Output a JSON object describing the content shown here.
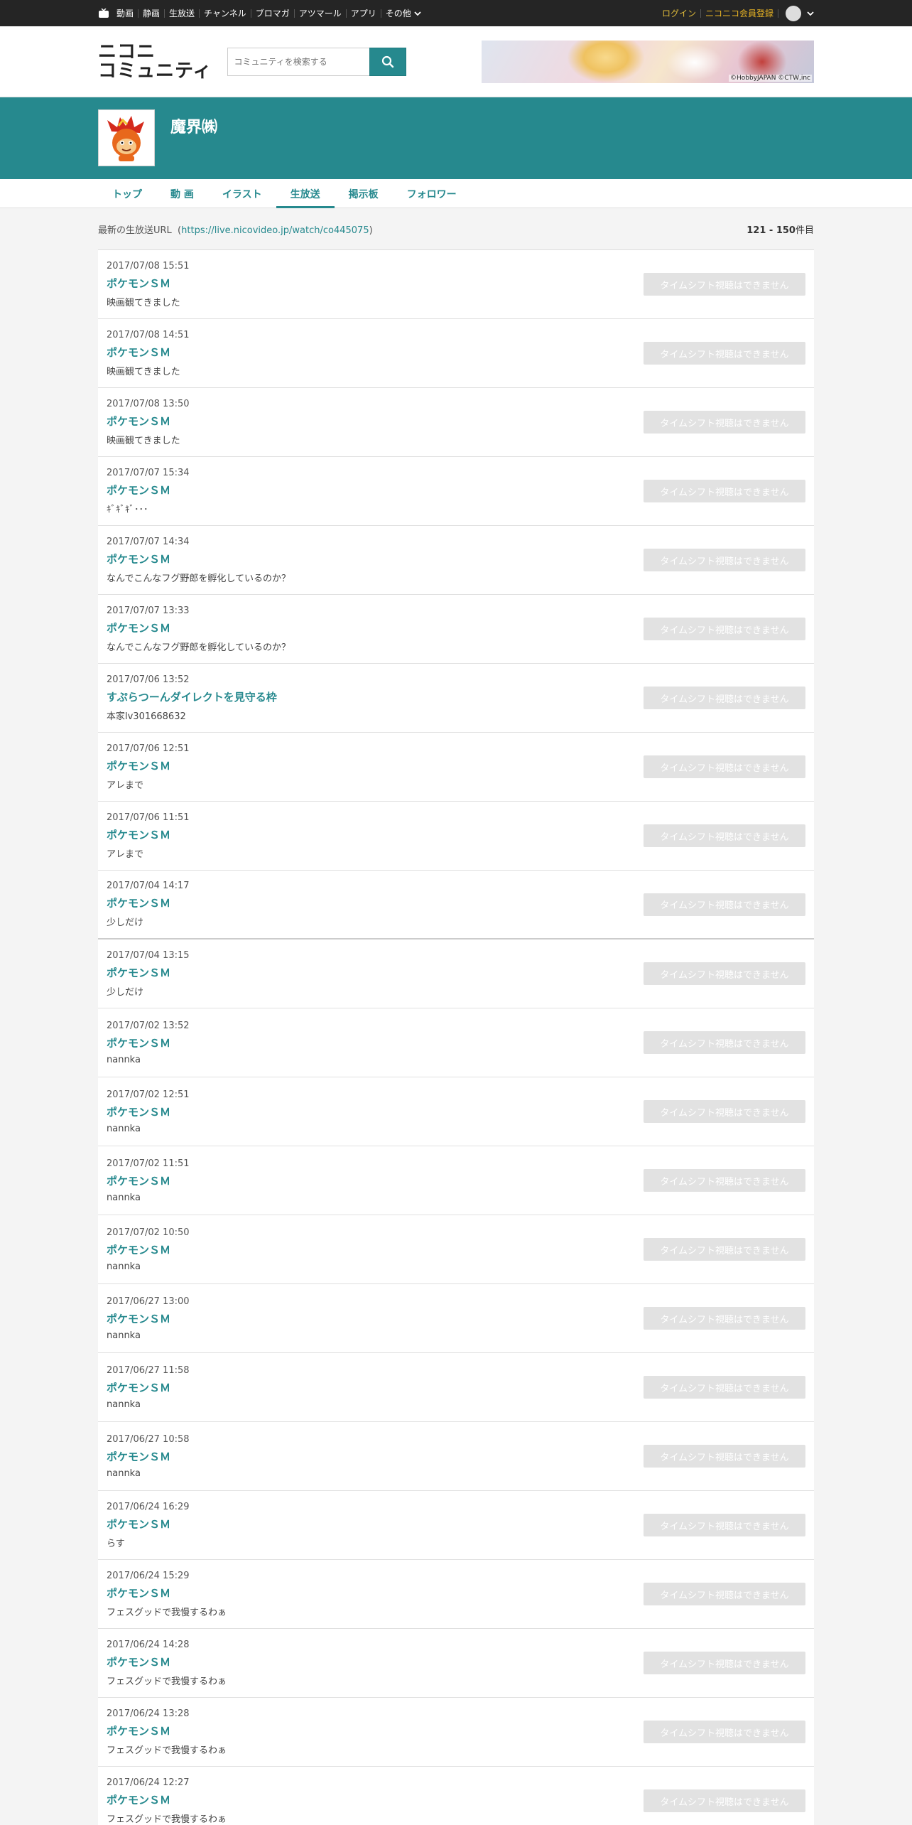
{
  "topbar": {
    "nav": [
      "動画",
      "静画",
      "生放送",
      "チャンネル",
      "ブロマガ",
      "アツマール",
      "アプリ"
    ],
    "more": "その他",
    "login": "ログイン",
    "register": "ニコニコ会員登録"
  },
  "header": {
    "logo_line1": "ニコニ",
    "logo_line2": "コミュニティ",
    "search_placeholder": "コミュニティを検索する",
    "banner_credit": "©HobbyJAPAN ©CTW,inc"
  },
  "community": {
    "name": "魔界㈱"
  },
  "tabs": [
    {
      "label": "トップ"
    },
    {
      "label": "動 画"
    },
    {
      "label": "イラスト"
    },
    {
      "label": "生放送"
    },
    {
      "label": "掲示板"
    },
    {
      "label": "フォロワー"
    }
  ],
  "active_tab": "生放送",
  "latest": {
    "label": "最新の生放送URL",
    "url": "https://live.nicovideo.jp/watch/co445075",
    "range": "121 - 150",
    "range_unit": "件目"
  },
  "timeshift_label": "タイムシフト視聴はできません",
  "broadcasts": [
    {
      "date": "2017/07/08 15:51",
      "title": "ポケモンＳＭ",
      "desc": "映画観てきました"
    },
    {
      "date": "2017/07/08 14:51",
      "title": "ポケモンＳＭ",
      "desc": "映画観てきました"
    },
    {
      "date": "2017/07/08 13:50",
      "title": "ポケモンＳＭ",
      "desc": "映画観てきました"
    },
    {
      "date": "2017/07/07 15:34",
      "title": "ポケモンＳＭ",
      "desc": "ｷﾞｷﾞｷﾞ･･･"
    },
    {
      "date": "2017/07/07 14:34",
      "title": "ポケモンＳＭ",
      "desc": "なんでこんなフグ野郎を孵化しているのか？"
    },
    {
      "date": "2017/07/07 13:33",
      "title": "ポケモンＳＭ",
      "desc": "なんでこんなフグ野郎を孵化しているのか？"
    },
    {
      "date": "2017/07/06 13:52",
      "title": "すぷらつーんダイレクトを見守る枠",
      "desc": "本家lv301668632"
    },
    {
      "date": "2017/07/06 12:51",
      "title": "ポケモンＳＭ",
      "desc": "アレまで"
    },
    {
      "date": "2017/07/06 11:51",
      "title": "ポケモンＳＭ",
      "desc": "アレまで"
    },
    {
      "date": "2017/07/04 14:17",
      "title": "ポケモンＳＭ",
      "desc": "少しだけ"
    },
    {
      "date": "2017/07/04 13:15",
      "title": "ポケモンＳＭ",
      "desc": "少しだけ"
    },
    {
      "date": "2017/07/02 13:52",
      "title": "ポケモンＳＭ",
      "desc": "nannka"
    },
    {
      "date": "2017/07/02 12:51",
      "title": "ポケモンＳＭ",
      "desc": "nannka"
    },
    {
      "date": "2017/07/02 11:51",
      "title": "ポケモンＳＭ",
      "desc": "nannka"
    },
    {
      "date": "2017/07/02 10:50",
      "title": "ポケモンＳＭ",
      "desc": "nannka"
    },
    {
      "date": "2017/06/27 13:00",
      "title": "ポケモンＳＭ",
      "desc": "nannka"
    },
    {
      "date": "2017/06/27 11:58",
      "title": "ポケモンＳＭ",
      "desc": "nannka"
    },
    {
      "date": "2017/06/27 10:58",
      "title": "ポケモンＳＭ",
      "desc": "nannka"
    },
    {
      "date": "2017/06/24 16:29",
      "title": "ポケモンＳＭ",
      "desc": "らす"
    },
    {
      "date": "2017/06/24 15:29",
      "title": "ポケモンＳＭ",
      "desc": "フェスグッドで我慢するわぁ"
    },
    {
      "date": "2017/06/24 14:28",
      "title": "ポケモンＳＭ",
      "desc": "フェスグッドで我慢するわぁ"
    },
    {
      "date": "2017/06/24 13:28",
      "title": "ポケモンＳＭ",
      "desc": "フェスグッドで我慢するわぁ"
    },
    {
      "date": "2017/06/24 12:27",
      "title": "ポケモンＳＭ",
      "desc": "フェスグッドで我慢するわぁ"
    }
  ]
}
